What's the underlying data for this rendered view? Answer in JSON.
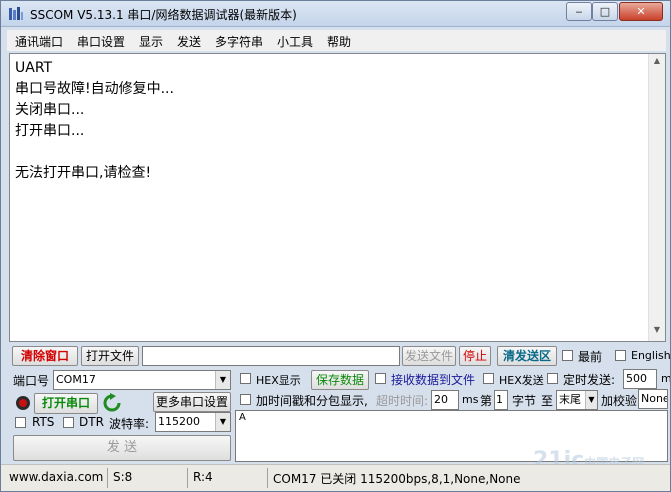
{
  "window": {
    "title": "SSCOM V5.13.1 串口/网络数据调试器(最新版本)",
    "min_label": "‒",
    "max_label": "□",
    "close_label": "✕"
  },
  "menu": [
    "通讯端口",
    "串口设置",
    "显示",
    "发送",
    "多字符串",
    "小工具",
    "帮助"
  ],
  "receive_lines": [
    "UART",
    "串口号故障!自动修复中...",
    "关闭串口...",
    "打开串口...",
    "",
    "无法打开串口,请检查!"
  ],
  "toolbar": {
    "clear_window": "清除窗口",
    "open_file": "打开文件",
    "file_path": "",
    "send_file": "发送文件",
    "stop": "停止",
    "clear_send": "清发送区",
    "topmost": "最前",
    "english": "English"
  },
  "port": {
    "port_label": "端口号",
    "port_value": "COM17",
    "more_settings": "更多串口设置",
    "open_port": "打开串口",
    "rts": "RTS",
    "dtr": "DTR",
    "baud_label": "波特率:",
    "baud_value": "115200",
    "send": "发 送"
  },
  "options": {
    "hex_display": "HEX显示",
    "save_data": "保存数据",
    "recv_to_file": "接收数据到文件",
    "hex_send": "HEX发送",
    "timed_send": "定时发送:",
    "timed_value": "500",
    "timed_unit": "m",
    "timestamp": "加时间戳和分包显示,",
    "timeout_label": "超时时间:",
    "timeout_value": "20",
    "ms": "ms",
    "di": "第",
    "byte_value": "1",
    "byte_label": "字节",
    "to": "至",
    "tail": "末尾",
    "checksum_label": "加校验",
    "checksum_value": "None"
  },
  "send_text": "A",
  "status": {
    "website": "www.daxia.com",
    "sent": "S:8",
    "received": "R:4",
    "port_status": "COM17 已关闭  115200bps,8,1,None,None"
  },
  "watermark": "21ic",
  "watermark_sub": "中国电子网"
}
